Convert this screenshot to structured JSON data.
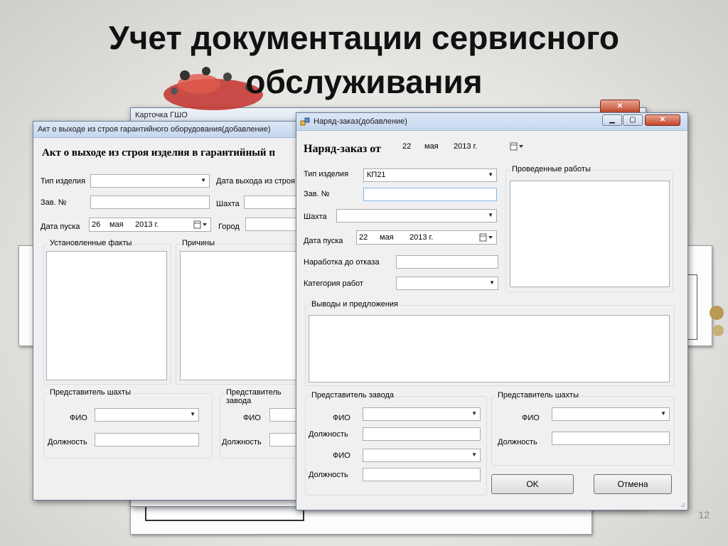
{
  "slide": {
    "title_line1": "Учет документации сервисного",
    "title_line2": "обслуживания",
    "page_number": "12"
  },
  "window_gsho": {
    "title": "Карточка ГШО"
  },
  "window_act": {
    "title": "Акт о выходе из строя гарантийного оборудования(добавление)",
    "heading": "Акт о выходе из строя изделия в гарантийный п",
    "labels": {
      "product_type": "Тип изделия",
      "serial": "Зав. №",
      "start_date": "Дата пуска",
      "failure_date": "Дата выхода из строя",
      "mine": "Шахта",
      "city": "Город"
    },
    "start_date": {
      "day": "26",
      "month": "мая",
      "year": "2013 г."
    },
    "groups": {
      "facts": "Установленные факты",
      "causes": "Причины",
      "mine_rep": "Представитель шахты",
      "plant_rep": "Представитель завода"
    },
    "rep_labels": {
      "fio": "ФИО",
      "position": "Должность"
    }
  },
  "window_order": {
    "title": "Наряд-заказ(добавление)",
    "heading": "Наряд-заказ от",
    "date": {
      "day": "22",
      "month": "мая",
      "year": "2013 г."
    },
    "labels": {
      "product_type": "Тип изделия",
      "serial": "Зав. №",
      "mine": "Шахта",
      "start_date": "Дата пуска",
      "runtime": "Наработка до отказа",
      "work_category": "Категория работ"
    },
    "product_type_value": "КП21",
    "start_date": {
      "day": "22",
      "month": "мая",
      "year": "2013 г."
    },
    "groups": {
      "works_done": "Проведенные работы",
      "conclusions": "Выводы и предложения",
      "plant_rep": "Представитель завода",
      "mine_rep": "Представитель шахты"
    },
    "rep_labels": {
      "fio": "ФИО",
      "position": "Должность"
    },
    "buttons": {
      "ok": "OK",
      "cancel": "Отмена"
    }
  },
  "colors": {
    "titlebar": "#c6d7ee",
    "close_button": "#c4452c",
    "form_bg": "#f0f0f0"
  }
}
